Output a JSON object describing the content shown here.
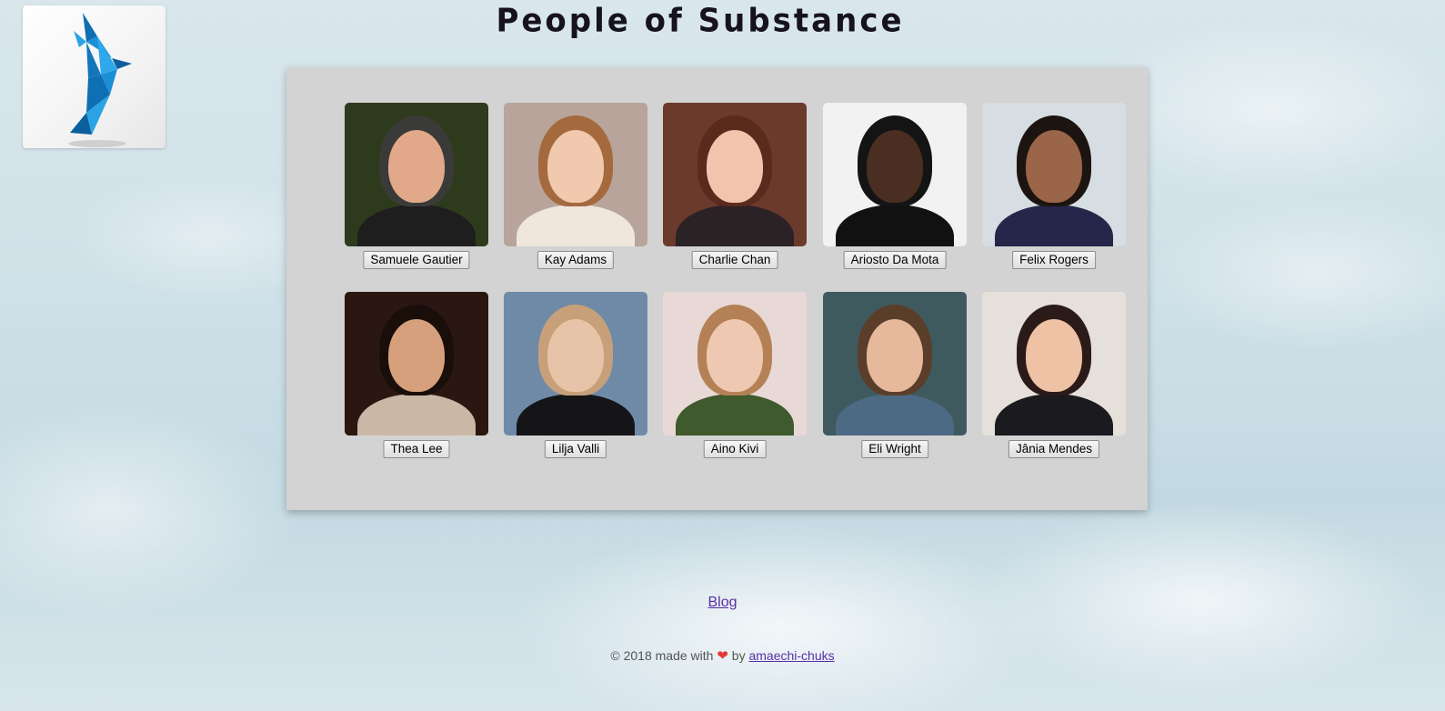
{
  "page": {
    "title": "People of Substance"
  },
  "logo": {
    "icon": "origami-bird-icon",
    "accent": "#1a8fd6"
  },
  "people": [
    {
      "name": "Samuele Gautier",
      "bg": "#2e3a1c",
      "skin": "#e1a98a",
      "hair": "#3a3a38",
      "shirt": "#1e1e1e"
    },
    {
      "name": "Kay Adams",
      "bg": "#b8a49a",
      "skin": "#f0c9ae",
      "hair": "#a46a3e",
      "shirt": "#efe6dc"
    },
    {
      "name": "Charlie Chan",
      "bg": "#6b3a2d",
      "skin": "#f1c4ae",
      "hair": "#5a2a1c",
      "shirt": "#2b2226"
    },
    {
      "name": "Ariosto Da Mota",
      "bg": "#f2f2f2",
      "skin": "#4a2e22",
      "hair": "#141414",
      "shirt": "#111111"
    },
    {
      "name": "Felix Rogers",
      "bg": "#d6dde3",
      "skin": "#9a6548",
      "hair": "#1c1410",
      "shirt": "#25264a"
    },
    {
      "name": "Thea Lee",
      "bg": "#2a1712",
      "skin": "#d7a07c",
      "hair": "#1a0e0b",
      "shirt": "#c9b8a6"
    },
    {
      "name": "Lilja Valli",
      "bg": "#6f8aa6",
      "skin": "#e7c3a8",
      "hair": "#c7a07a",
      "shirt": "#151518"
    },
    {
      "name": "Aino Kivi",
      "bg": "#e9d9d6",
      "skin": "#efc8b2",
      "hair": "#b48156",
      "shirt": "#3f5a2c"
    },
    {
      "name": "Eli Wright",
      "bg": "#3f5a5f",
      "skin": "#e6b89c",
      "hair": "#5a3e2a",
      "shirt": "#4d6a84"
    },
    {
      "name": "Jânia Mendes",
      "bg": "#e6e0da",
      "skin": "#efc2a6",
      "hair": "#2a1b18",
      "shirt": "#1b1b1f"
    }
  ],
  "blog": {
    "label": "Blog"
  },
  "footer": {
    "prefix": "© 2018 made with",
    "heart": "❤",
    "by": "by",
    "author": "amaechi-chuks"
  }
}
